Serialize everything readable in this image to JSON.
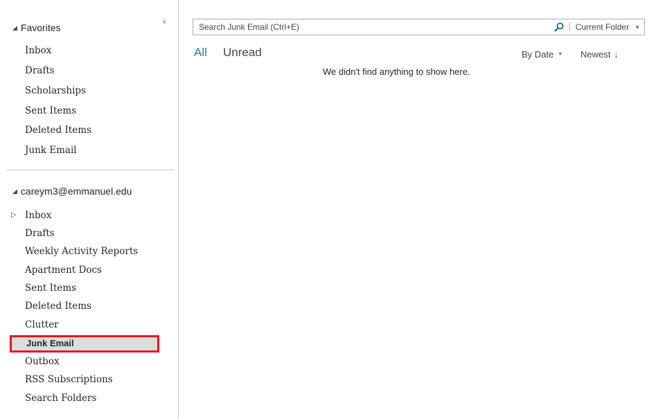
{
  "folder_pane": {
    "favorites": {
      "header": "Favorites",
      "items": [
        "Inbox",
        "Drafts",
        "Scholarships",
        "Sent Items",
        "Deleted Items",
        "Junk Email"
      ]
    },
    "account": {
      "header": "careym3@emmanuel.edu",
      "inbox_expander": "▷",
      "items": [
        "Inbox",
        "Drafts",
        "Weekly Activity Reports",
        "Apartment Docs",
        "Sent Items",
        "Deleted Items",
        "Clutter",
        "Junk Email",
        "Outbox",
        "RSS Subscriptions",
        "Search Folders"
      ],
      "selected": "Junk Email"
    },
    "collapse_glyph": "‹",
    "expanded_glyph": "◢"
  },
  "search": {
    "placeholder": "Search Junk Email (Ctrl+E)",
    "scope": "Current Folder"
  },
  "filters": {
    "all": "All",
    "unread": "Unread"
  },
  "sort": {
    "by": "By Date",
    "order": "Newest",
    "order_arrow": "↓"
  },
  "message_list": {
    "empty_text": "We didn't find anything to show here."
  },
  "colors": {
    "accent": "#2a74c5",
    "highlight_box": "#e8141e",
    "selection": "#dcdcdc"
  },
  "icons": {
    "search": "search-icon",
    "collapse": "chevron-left-icon",
    "scope_dropdown": "caret-down-icon"
  }
}
